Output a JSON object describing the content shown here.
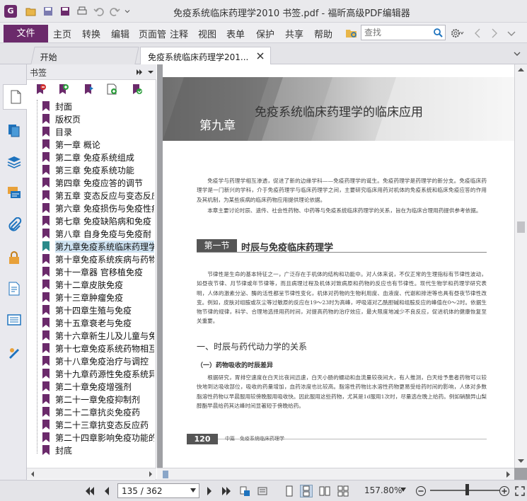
{
  "window": {
    "title": "免疫系统临床药理学2010 书签.pdf - 福昕高级PDF编辑器"
  },
  "menu": {
    "file": "文件",
    "items": [
      "主页",
      "转换",
      "编辑",
      "页面管",
      "注释",
      "视图",
      "表单",
      "保护",
      "共享",
      "帮助"
    ],
    "search_placeholder": "查找"
  },
  "tabs": [
    {
      "label": "开始"
    },
    {
      "label": "免疫系统临床药理学201..."
    }
  ],
  "bookmarks_panel": {
    "title": "书签",
    "items": [
      {
        "label": "封面"
      },
      {
        "label": "版权页"
      },
      {
        "label": "目录"
      },
      {
        "label": "第一章 概论"
      },
      {
        "label": "第二章 免疫系统组成"
      },
      {
        "label": "第三章 免疫系统功能"
      },
      {
        "label": "第四章 免疫应答的调节"
      },
      {
        "label": "第五章 变态反应与变态反应"
      },
      {
        "label": "第六章 免疫损伤与免疫性疾"
      },
      {
        "label": "第七章 免疫缺陷病和免疫"
      },
      {
        "label": "第八章 自身免疫与免疫耐"
      },
      {
        "label": "第九章免疫系统临床药理学",
        "selected": true
      },
      {
        "label": "第十章免疫系统疾病与药物"
      },
      {
        "label": "第十一章器 官移植免疫"
      },
      {
        "label": "第十二章皮肤免疫"
      },
      {
        "label": "第十三章肿瘤免疫"
      },
      {
        "label": "第十四章生殖与免疫"
      },
      {
        "label": "第十五章衰老与免疫"
      },
      {
        "label": "第十六章新生儿及儿童与免"
      },
      {
        "label": "第十七章免疫系统药物相互"
      },
      {
        "label": "第十八章免疫治疗与调控"
      },
      {
        "label": "第十九章药源性免疫系统异"
      },
      {
        "label": "第二十章免疫增强剂"
      },
      {
        "label": "第二十一章免疫抑制剂"
      },
      {
        "label": "第二十二章抗炎免疫药"
      },
      {
        "label": "第二十三章抗变态反应药"
      },
      {
        "label": "第二十四章影响免疫功能的"
      },
      {
        "label": "封底"
      }
    ]
  },
  "document": {
    "chapter_label": "第九章",
    "chapter_title": "免疫系统临床药理学的临床应用",
    "intro": "免疫学与药理学相互渗透，促进了新的边缘学科——免疫药理学的诞生。免疫药理学是药理学的新分支。免疫临床药理学是一门新兴的学科，介于免疫药理学与临床药理学之间，主要研究临床用药对机体的免疫系统和临床免疫应答的作用及其机制，为某些疾病的临床药物应用提供理论依据。",
    "intro2": "本章主要讨论时辰、遗传、社会性药物、中药等与免疫系统临床药理学的关系，旨在为临床合理用药提供参考依据。",
    "section_number": "第一节",
    "section_title": "时辰与免疫临床药理学",
    "section_para": "节律性是生命的基本特征之一，广泛存在于机体的结构和功能中。对人体来说，不仅正常的生理指标有节律性波动，如昼夜节律、月节律或年节律等，而且病理过程及机体对致病原和药物的反应也有节律性。现代生物学和药理学研究表明，人体的激素分泌、酶的活性都呈节律性变化，机体对药物的生物利用度、血液度、代谢和排泄等也具有昼夜节律性改变。例如，皮肤对组胺或灰尘等过敏原的反应在19～23时为高峰，呼吸道对乙酰胆碱和组胺反应的峰值在0～2时。依据生物节律的规律，科学、合理地选择用药时间，对提高药物的治疗效应，最大限度地减少不良反应，促进机体的健康恢复至关重要。",
    "subheading1": "一、时辰与药代动力学的关系",
    "subheading2": "（一）药物吸收的时辰差异",
    "body_para": "根据研究，胃排空速度在白天比夜间迅速，白天小肠的蠕动和血流量较夜间大，有人推测，白天给予患者药物可以较快地到达吸收部位，吸收的药量增加，血药浓度也比较高。脂溶性药物比水溶性药物更易受给药时间的影响，人体对多数脂溶性药物以早晨服用较傍晚服用吸收快。因此服用这些药物，尤其是1d服用1次时，尽量选在晚上给药。例如硝酸异山梨醇酯早晨给药其达峰时间显著短于傍晚给药。",
    "page_number": "120",
    "footer_text": "中篇　免疫系统临床药理学"
  },
  "status": {
    "page_field": "135 / 362",
    "zoom": "157.80%"
  },
  "colors": {
    "brand": "#6b2a6b",
    "accent": "#1e73be"
  }
}
